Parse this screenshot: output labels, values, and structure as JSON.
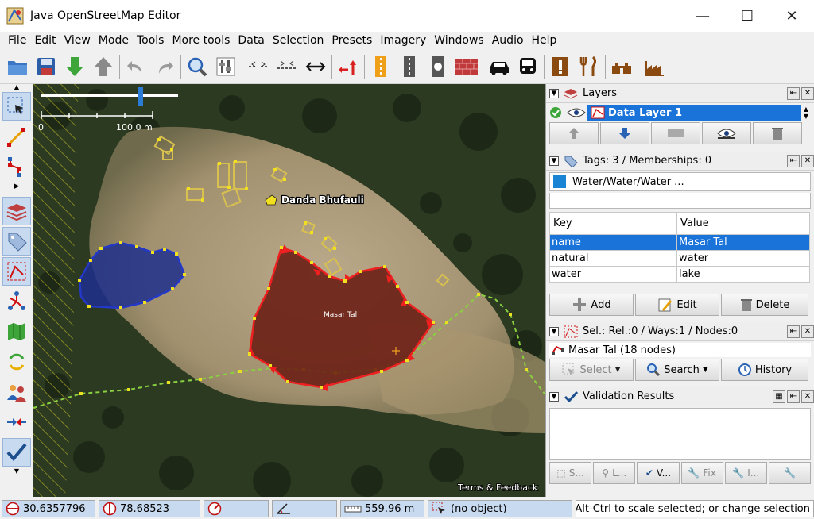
{
  "window": {
    "title": "Java OpenStreetMap Editor"
  },
  "menu": [
    "File",
    "Edit",
    "View",
    "Mode",
    "Tools",
    "More tools",
    "Data",
    "Selection",
    "Presets",
    "Imagery",
    "Windows",
    "Audio",
    "Help"
  ],
  "map": {
    "scale_start": "0",
    "scale_end": "100.0 m",
    "place_label": "Danda Bhufauli",
    "lake_label": "Masar Tal",
    "attribution": "Terms & Feedback"
  },
  "layers": {
    "title": "Layers",
    "layer_name": "Data Layer 1"
  },
  "tags": {
    "title": "Tags: 3 / Memberships: 0",
    "object_type": "Water/Water/Water ...",
    "col_key": "Key",
    "col_value": "Value",
    "rows": [
      {
        "key": "name",
        "value": "Masar Tal"
      },
      {
        "key": "natural",
        "value": "water"
      },
      {
        "key": "water",
        "value": "lake"
      }
    ],
    "add_label": "Add",
    "edit_label": "Edit",
    "delete_label": "Delete"
  },
  "selection": {
    "title": "Sel.: Rel.:0 / Ways:1 / Nodes:0",
    "item": "Masar Tal (18 nodes)",
    "select_label": "Select",
    "search_label": "Search",
    "history_label": "History"
  },
  "validation": {
    "title": "Validation Results",
    "btn_labels": [
      "S...",
      "L...",
      "V...",
      "Fix",
      "I...",
      ""
    ]
  },
  "status": {
    "lat": "30.6357796",
    "lon": "78.68523",
    "distance": "559.96 m",
    "object": "(no object)",
    "message": "ed; Alt-Ctrl to scale selected; or change selection"
  },
  "colors": {
    "selection_blue": "#1a73d9",
    "selected_way_red": "#e8201c",
    "water_blue": "#1c2e8c",
    "path_green": "#7ad03a"
  }
}
